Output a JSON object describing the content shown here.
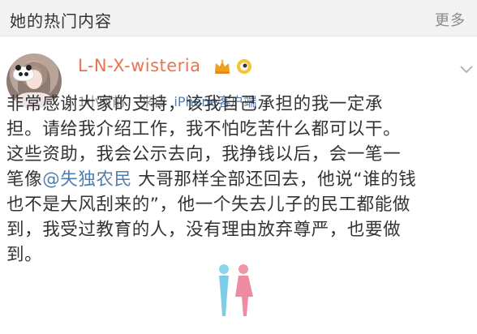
{
  "header": {
    "title": "她的热门内容",
    "more_label": "更多"
  },
  "post": {
    "username": "L-N-X-wisteria",
    "time": "1小时前",
    "from_label": "来自",
    "client": "iPhone客户端",
    "lines": [
      {
        "before": "非常感谢大家的支持，该我自己承担的我一定承",
        "mention": "",
        "after": ""
      },
      {
        "before": "担。请给我介绍工作，我不怕吃苦什么都可以干。",
        "mention": "",
        "after": ""
      },
      {
        "before": "这些资助，我会公示去向，我挣钱以后，会一笔一",
        "mention": "",
        "after": ""
      },
      {
        "before": "笔像",
        "mention": "@失独农民",
        "after": " 大哥那样全部还回去，他说“谁的钱"
      },
      {
        "before": "也不是大风刮来的”，他一个失去儿子的民工都能做",
        "mention": "",
        "after": ""
      },
      {
        "before": "到，我受过教育的人，没有理由放弃尊严，也要做",
        "mention": "",
        "after": ""
      },
      {
        "before": "到。",
        "mention": "",
        "after": ""
      }
    ]
  },
  "icons": {
    "crown": "crown-icon",
    "vip": "vip-badge-icon",
    "chevron": "chevron-down-icon",
    "watermark": "couple-figures-icon"
  },
  "colors": {
    "username": "#eb7350",
    "link": "#507daf",
    "meta": "#8a8a8a",
    "header_bg": "#f2f2f2"
  }
}
